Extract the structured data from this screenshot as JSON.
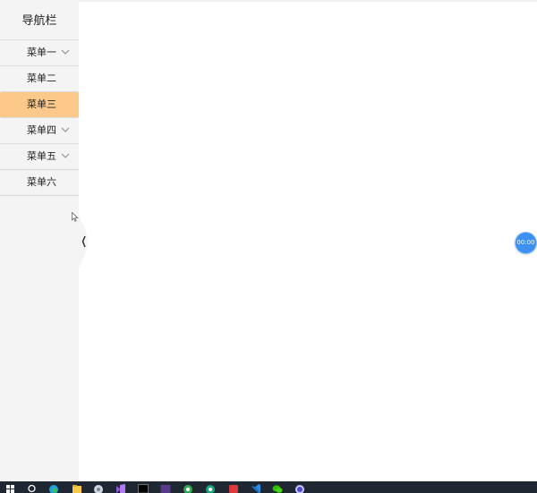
{
  "sidebar": {
    "title": "导航栏",
    "items": [
      {
        "label": "菜单一",
        "has_children": true
      },
      {
        "label": "菜单二",
        "has_children": false
      },
      {
        "label": "菜单三",
        "has_children": false,
        "active": true
      },
      {
        "label": "菜单四",
        "has_children": true
      },
      {
        "label": "菜单五",
        "has_children": true
      },
      {
        "label": "菜单六",
        "has_children": false
      }
    ]
  },
  "collapse_button": {
    "icon": "chevron-left-icon"
  },
  "timer": {
    "label": "00:00",
    "color": "#3d8ff0"
  },
  "colors": {
    "sidebar_bg": "#f4f4f4",
    "active_bg": "#fcc98a",
    "taskbar_bg": "#1f2733"
  },
  "taskbar": {
    "icons": [
      "windows-start-icon",
      "search-icon",
      "edge-icon",
      "file-explorer-icon",
      "app-icon",
      "visual-studio-icon",
      "terminal-icon",
      "app-icon",
      "chrome-icon",
      "chrome-icon",
      "app-icon",
      "vscode-icon",
      "wechat-icon",
      "app-icon"
    ]
  }
}
